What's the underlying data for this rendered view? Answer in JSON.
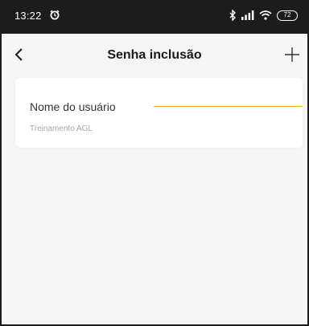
{
  "status_bar": {
    "time": "13:22",
    "battery": "72",
    "icons": [
      "alarm-icon",
      "bluetooth-icon",
      "signal-icon",
      "wifi-icon",
      "battery-icon"
    ]
  },
  "nav": {
    "title": "Senha inclusão",
    "back_icon": "chevron-left-icon",
    "add_icon": "plus-icon"
  },
  "form": {
    "field_label": "Nome do usuário",
    "field_value": "Treinamento AGL"
  },
  "colors": {
    "status_bar": "#1c1c1c",
    "background": "#f5f5f5",
    "card": "#ffffff",
    "accent": "#f5a623"
  }
}
